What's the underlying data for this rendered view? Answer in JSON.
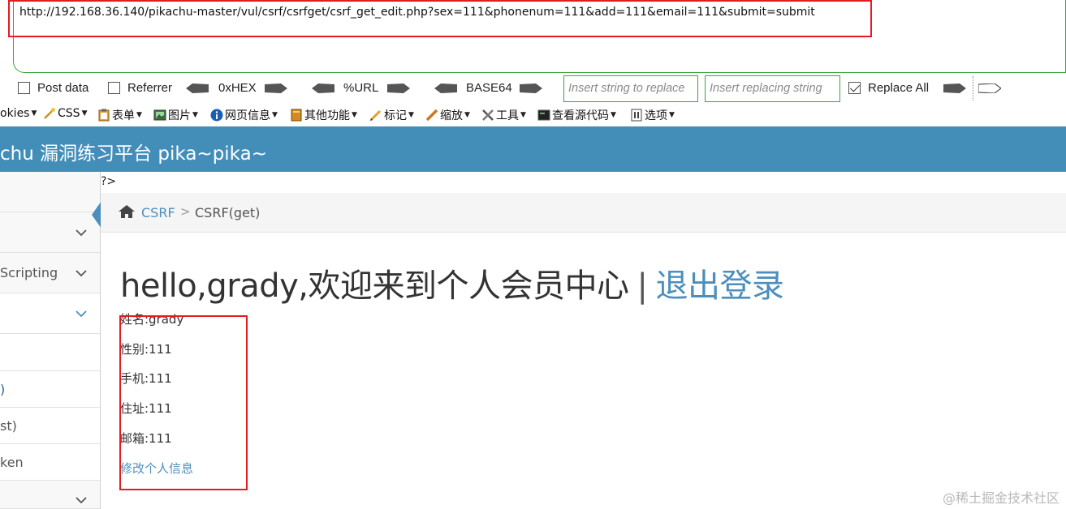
{
  "url_bar": {
    "url": "http://192.168.36.140/pikachu-master/vul/csrf/csrfget/csrf_get_edit.php?sex=111&phonenum=111&add=111&email=111&submit=submit"
  },
  "hackbar": {
    "post_data_label": "Post data",
    "referrer_label": "Referrer",
    "hex_label": "0xHEX",
    "url_label": "%URL",
    "base64_label": "BASE64",
    "replace_placeholder": "Insert string to replace",
    "replacing_placeholder": "Insert replacing string",
    "replace_all_label": "Replace All",
    "replace_all_checked": true
  },
  "webdev_toolbar": {
    "items": [
      "okies",
      "CSS",
      "表单",
      "图片",
      "网页信息",
      "其他功能",
      "标记",
      "缩放",
      "工具",
      "查看源代码",
      "选项"
    ]
  },
  "site": {
    "title": "chu 漏洞练习平台 pika~pika~"
  },
  "sidebar": {
    "items": [
      {
        "label": ""
      },
      {
        "label": ""
      },
      {
        "label": "Scripting"
      },
      {
        "label": ""
      },
      {
        "label": ""
      },
      {
        "label": ")"
      },
      {
        "label": "st)"
      },
      {
        "label": "ken"
      },
      {
        "label": ""
      }
    ]
  },
  "content": {
    "php_leak": "?>",
    "breadcrumb": {
      "link": "CSRF",
      "separator": ">",
      "current": "CSRF(get)"
    },
    "title": {
      "greeting": "hello,grady,欢迎来到个人会员中心",
      "separator": "|",
      "logout": "退出登录"
    },
    "info": {
      "name": "姓名:grady",
      "sex": "性别:111",
      "phone": "手机:111",
      "address": "住址:111",
      "email": "邮箱:111"
    },
    "edit_link": "修改个人信息"
  },
  "watermark": "@稀土掘金技术社区",
  "colors": {
    "header_blue": "#438eb9",
    "link_blue": "#4c8fbd",
    "highlight_red": "#e41b23",
    "hackbar_green": "#3aa63a"
  }
}
